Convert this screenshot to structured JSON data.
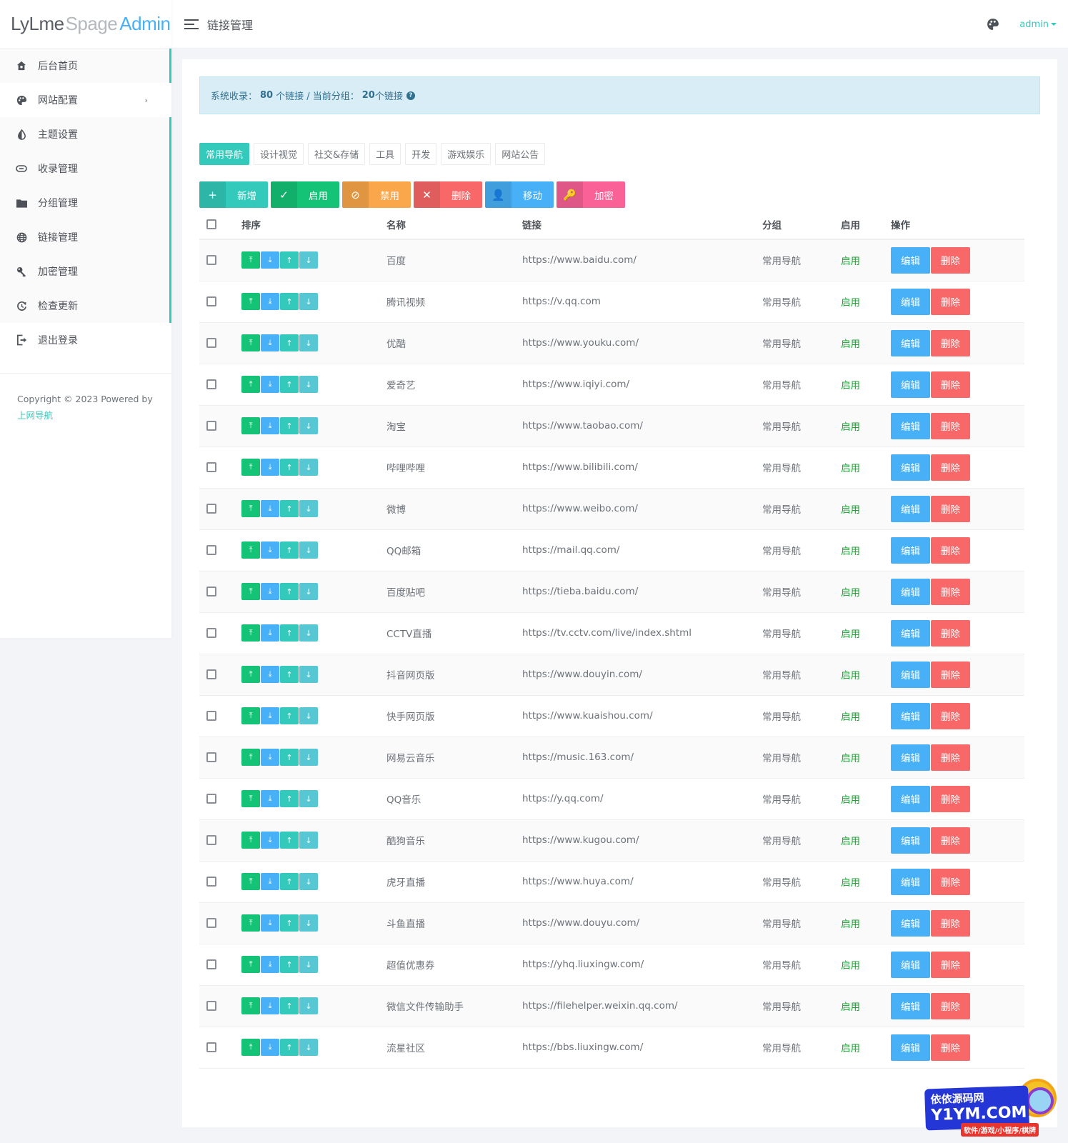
{
  "logo": {
    "part1": "LyLme",
    "part2": "Spage",
    "part3": "Admin"
  },
  "topbar": {
    "title": "链接管理",
    "user": "admin"
  },
  "sidebar": {
    "items": [
      {
        "label": "后台首页",
        "icon": "home-icon"
      },
      {
        "label": "网站配置",
        "icon": "palette-icon",
        "has_arrow": true
      },
      {
        "label": "主题设置",
        "icon": "contrast-icon"
      },
      {
        "label": "收录管理",
        "icon": "link-icon"
      },
      {
        "label": "分组管理",
        "icon": "folder-icon"
      },
      {
        "label": "链接管理",
        "icon": "globe-icon"
      },
      {
        "label": "加密管理",
        "icon": "key-icon"
      },
      {
        "label": "检查更新",
        "icon": "refresh-icon"
      },
      {
        "label": "退出登录",
        "icon": "logout-icon"
      }
    ],
    "arrow": "›",
    "footer": {
      "copyright": "Copyright © 2023 Powered by",
      "link": "上网导航"
    }
  },
  "alert": {
    "prefix": "系统收录：",
    "total": "80",
    "total_suffix": "个链接 / 当前分组：",
    "group_count": "20",
    "group_suffix": "个链接",
    "help": "?"
  },
  "group_tabs": [
    "常用导航",
    "设计视觉",
    "社交&存储",
    "工具",
    "开发",
    "游戏娱乐",
    "网站公告"
  ],
  "toolbar": [
    {
      "label": "新增",
      "icon": "+",
      "color": "#33cabb",
      "name": "add"
    },
    {
      "label": "启用",
      "icon": "✓",
      "color": "#15c377",
      "name": "enable"
    },
    {
      "label": "禁用",
      "icon": "⊘",
      "color": "#faa64b",
      "name": "disable"
    },
    {
      "label": "删除",
      "icon": "✕",
      "color": "#f96868",
      "name": "delete"
    },
    {
      "label": "移动",
      "icon": "👤",
      "color": "#48b0f7",
      "name": "move"
    },
    {
      "label": "加密",
      "icon": "🔑",
      "color": "#f96197",
      "name": "encrypt"
    }
  ],
  "table": {
    "headers": [
      "排序",
      "名称",
      "链接",
      "分组",
      "启用",
      "操作"
    ],
    "sort_buttons": [
      {
        "icon": "⤒",
        "color": "#15c377",
        "name": "move-top"
      },
      {
        "icon": "⤓",
        "color": "#48b0f7",
        "name": "move-bottom"
      },
      {
        "icon": "↑",
        "color": "#33cabb",
        "name": "move-up"
      },
      {
        "icon": "↓",
        "color": "#57c7d4",
        "name": "move-down"
      }
    ],
    "edit_label": "编辑",
    "delete_label": "删除",
    "rows": [
      {
        "name": "百度",
        "url": "https://www.baidu.com/",
        "group": "常用导航",
        "status": "启用"
      },
      {
        "name": "腾讯视频",
        "url": "https://v.qq.com",
        "group": "常用导航",
        "status": "启用"
      },
      {
        "name": "优酷",
        "url": "https://www.youku.com/",
        "group": "常用导航",
        "status": "启用"
      },
      {
        "name": "爱奇艺",
        "url": "https://www.iqiyi.com/",
        "group": "常用导航",
        "status": "启用"
      },
      {
        "name": "淘宝",
        "url": "https://www.taobao.com/",
        "group": "常用导航",
        "status": "启用"
      },
      {
        "name": "哔哩哔哩",
        "url": "https://www.bilibili.com/",
        "group": "常用导航",
        "status": "启用"
      },
      {
        "name": "微博",
        "url": "https://www.weibo.com/",
        "group": "常用导航",
        "status": "启用"
      },
      {
        "name": "QQ邮箱",
        "url": "https://mail.qq.com/",
        "group": "常用导航",
        "status": "启用"
      },
      {
        "name": "百度贴吧",
        "url": "https://tieba.baidu.com/",
        "group": "常用导航",
        "status": "启用"
      },
      {
        "name": "CCTV直播",
        "url": "https://tv.cctv.com/live/index.shtml",
        "group": "常用导航",
        "status": "启用"
      },
      {
        "name": "抖音网页版",
        "url": "https://www.douyin.com/",
        "group": "常用导航",
        "status": "启用"
      },
      {
        "name": "快手网页版",
        "url": "https://www.kuaishou.com/",
        "group": "常用导航",
        "status": "启用"
      },
      {
        "name": "网易云音乐",
        "url": "https://music.163.com/",
        "group": "常用导航",
        "status": "启用"
      },
      {
        "name": "QQ音乐",
        "url": "https://y.qq.com/",
        "group": "常用导航",
        "status": "启用"
      },
      {
        "name": "酷狗音乐",
        "url": "https://www.kugou.com/",
        "group": "常用导航",
        "status": "启用"
      },
      {
        "name": "虎牙直播",
        "url": "https://www.huya.com/",
        "group": "常用导航",
        "status": "启用"
      },
      {
        "name": "斗鱼直播",
        "url": "https://www.douyu.com/",
        "group": "常用导航",
        "status": "启用"
      },
      {
        "name": "超值优惠券",
        "url": "https://yhq.liuxingw.com/",
        "group": "常用导航",
        "status": "启用"
      },
      {
        "name": "微信文件传输助手",
        "url": "https://filehelper.weixin.qq.com/",
        "group": "常用导航",
        "status": "启用"
      },
      {
        "name": "流星社区",
        "url": "https://bbs.liuxingw.com/",
        "group": "常用导航",
        "status": "启用"
      }
    ]
  },
  "colors": {
    "primary": "#33cabb",
    "info": "#48b0f7",
    "danger": "#f96868",
    "success": "#15c377",
    "enabled_text": "#15a52f"
  },
  "watermark": {
    "line1": "依依源码网",
    "line2": "Y1YM.COM",
    "sub": "软件/游戏/小程序/棋牌"
  }
}
